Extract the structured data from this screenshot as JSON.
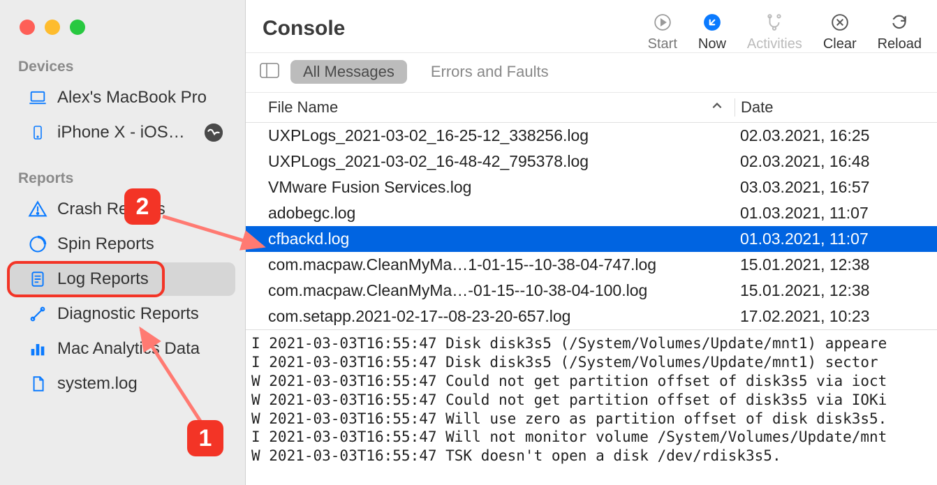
{
  "app_title": "Console",
  "toolbar": {
    "start": "Start",
    "now": "Now",
    "activities": "Activities",
    "clear": "Clear",
    "reload": "Reload"
  },
  "filters": {
    "all_messages": "All Messages",
    "errors_faults": "Errors and Faults"
  },
  "sidebar": {
    "devices_header": "Devices",
    "devices": [
      {
        "label": "Alex's MacBook Pro",
        "icon": "laptop"
      },
      {
        "label": "iPhone X - iOS…",
        "icon": "phone",
        "badge": true
      }
    ],
    "reports_header": "Reports",
    "reports": [
      {
        "label": "Crash Reports",
        "icon": "warning"
      },
      {
        "label": "Spin Reports",
        "icon": "spinner"
      },
      {
        "label": "Log Reports",
        "icon": "document",
        "selected": true
      },
      {
        "label": "Diagnostic Reports",
        "icon": "tools"
      },
      {
        "label": "Mac Analytics Data",
        "icon": "bars"
      },
      {
        "label": "system.log",
        "icon": "file"
      }
    ]
  },
  "table": {
    "header_filename": "File Name",
    "header_date": "Date",
    "rows": [
      {
        "filename": "UXPLogs_2021-03-02_16-25-12_338256.log",
        "date": "02.03.2021, 16:25"
      },
      {
        "filename": "UXPLogs_2021-03-02_16-48-42_795378.log",
        "date": "02.03.2021, 16:48"
      },
      {
        "filename": "VMware Fusion Services.log",
        "date": "03.03.2021, 16:57"
      },
      {
        "filename": "adobegc.log",
        "date": "01.03.2021, 11:07"
      },
      {
        "filename": "cfbackd.log",
        "date": "01.03.2021, 11:07",
        "selected": true
      },
      {
        "filename": "com.macpaw.CleanMyMa…1-01-15--10-38-04-747.log",
        "date": "15.01.2021, 12:38"
      },
      {
        "filename": "com.macpaw.CleanMyMa…-01-15--10-38-04-100.log",
        "date": "15.01.2021, 12:38"
      },
      {
        "filename": "com.setapp.2021-02-17--08-23-20-657.log",
        "date": "17.02.2021, 10:23"
      }
    ]
  },
  "log_lines": [
    "I 2021-03-03T16:55:47 Disk disk3s5 (/System/Volumes/Update/mnt1) appeare",
    "I 2021-03-03T16:55:47 Disk disk3s5 (/System/Volumes/Update/mnt1) sector",
    "W 2021-03-03T16:55:47 Could not get partition offset of disk3s5 via ioct",
    "W 2021-03-03T16:55:47 Could not get partition offset of disk3s5 via IOKi",
    "W 2021-03-03T16:55:47 Will use zero as partition offset of disk disk3s5.",
    "I 2021-03-03T16:55:47 Will not monitor volume /System/Volumes/Update/mnt",
    "W 2021-03-03T16:55:47 TSK doesn't open a disk /dev/rdisk3s5."
  ],
  "annotations": {
    "badge1": "1",
    "badge2": "2"
  },
  "colors": {
    "accent_blue": "#0a7aff",
    "selection_blue": "#0064e1",
    "annotation_red": "#f33426"
  }
}
